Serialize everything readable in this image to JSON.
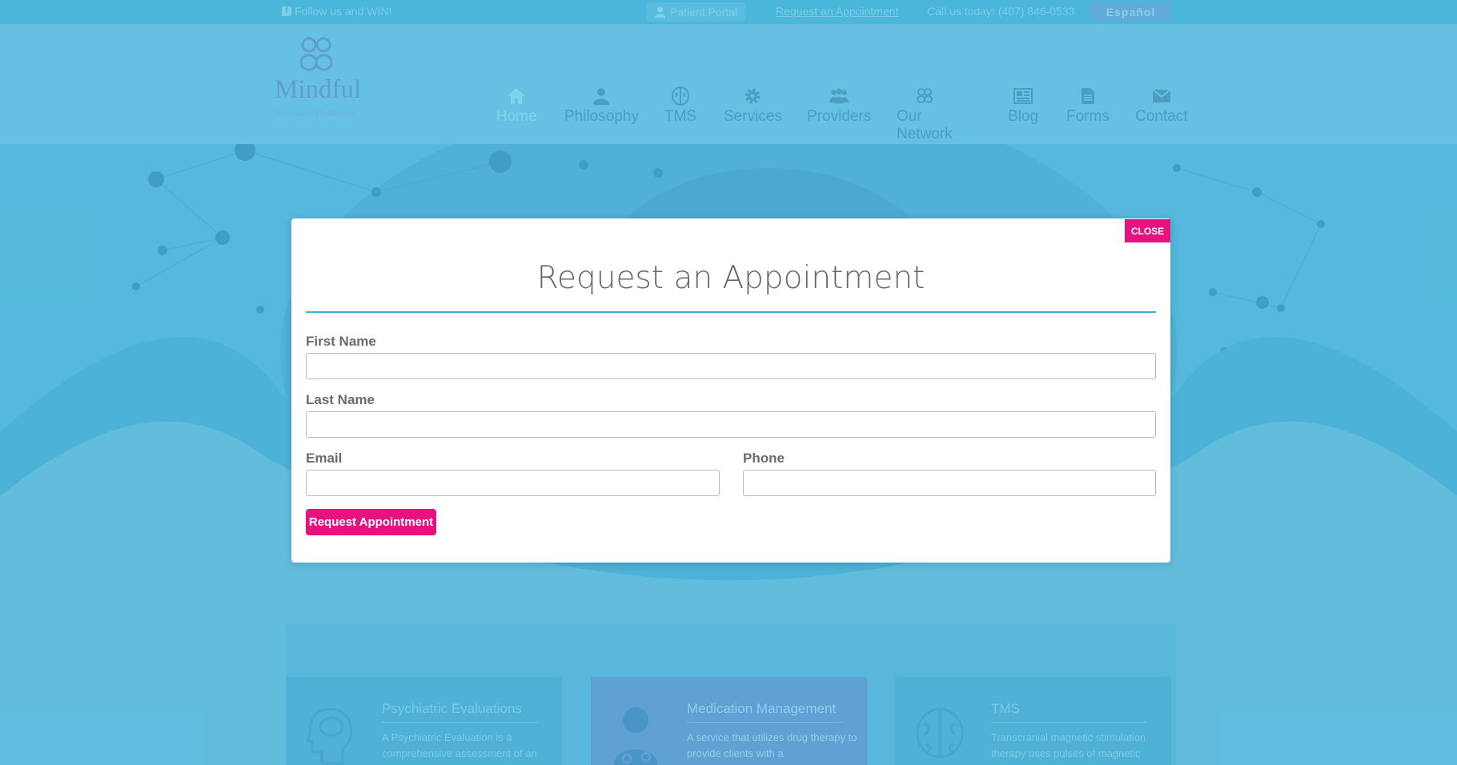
{
  "topbar": {
    "social": "Follow us and WIN!",
    "patient_portal": "Patient Portal",
    "request_link": "Request an Appointment",
    "call": "Call us today! (407) 846-0533",
    "language": "Español"
  },
  "logo": {
    "name": "Mindful",
    "tagline": "Behavioral Healthcare"
  },
  "nav": {
    "items": [
      {
        "label": "Home",
        "icon": "home-icon"
      },
      {
        "label": "Philosophy",
        "icon": "person-icon"
      },
      {
        "label": "TMS",
        "icon": "brain-icon"
      },
      {
        "label": "Services",
        "icon": "gear-icon"
      },
      {
        "label": "Providers",
        "icon": "group-icon"
      },
      {
        "label": "Our Network",
        "icon": "network-icon"
      },
      {
        "label": "Blog",
        "icon": "newspaper-icon"
      },
      {
        "label": "Forms",
        "icon": "document-icon"
      },
      {
        "label": "Contact",
        "icon": "envelope-icon"
      }
    ],
    "active": "Home"
  },
  "cards": [
    {
      "title": "Psychiatric Evaluations",
      "text": "A Psychiatric Evaluation is a comprehensive assessment of an",
      "icon": "head-brain-icon"
    },
    {
      "title": "Medication Management",
      "text": "A service that utilizes drug therapy to provide clients with a",
      "icon": "doctor-icon"
    },
    {
      "title": "TMS",
      "text": "Transcranial magnetic stimulation therapy uses pulses of magnetic",
      "icon": "brain-icon"
    }
  ],
  "modal": {
    "close_label": "CLOSE",
    "title": "Request an Appointment",
    "first_name_label": "First Name",
    "first_name_value": "",
    "last_name_label": "Last Name",
    "last_name_value": "",
    "email_label": "Email",
    "email_value": "",
    "phone_label": "Phone",
    "phone_value": "",
    "submit_label": "Request Appointment"
  },
  "colors": {
    "accent_pink": "#e6127f",
    "accent_blue": "#3cb3dc",
    "background": "#5cb9da"
  }
}
